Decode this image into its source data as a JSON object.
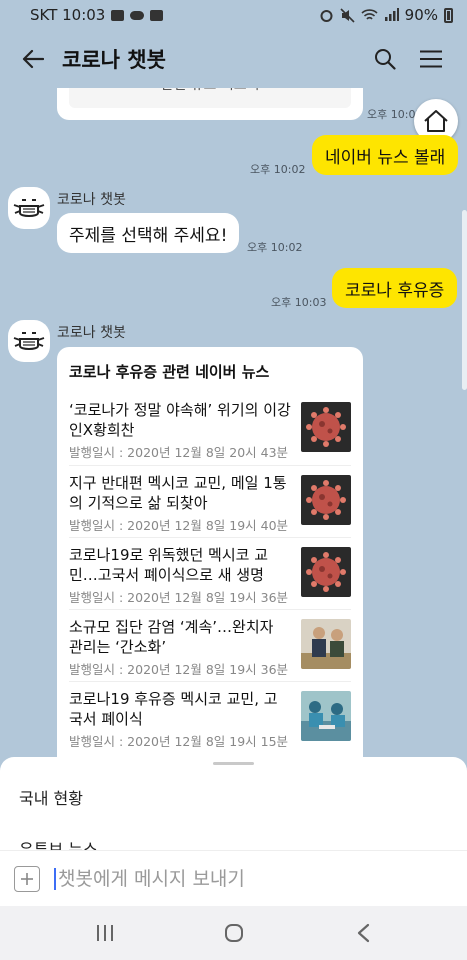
{
  "status_bar": {
    "carrier_time": "SKT 10:03",
    "battery": "90%"
  },
  "header": {
    "title": "코로나 챗봇",
    "icons": [
      "back-arrow-icon",
      "search-icon",
      "menu-icon"
    ]
  },
  "chat": {
    "partial_card_button": "관련 뉴스 더보기",
    "messages": {
      "m1_time": "오후 10:02",
      "m2_text": "네이버 뉴스 볼래",
      "m2_time": "오후 10:02",
      "m3_sender": "코로나 챗봇",
      "m3_text": "주제를 선택해 주세요!",
      "m3_time": "오후 10:02",
      "m4_text": "코로나 후유증",
      "m4_time": "오후 10:03",
      "m5_sender": "코로나 챗봇"
    },
    "news_card": {
      "title": "코로나 후유증 관련 네이버 뉴스",
      "items": [
        {
          "headline": "‘코로나가 정말 야속해’ 위기의 이강인X황희찬",
          "date": "발행일시 : 2020년 12월 8일 20시 43분",
          "thumb": "virus-image"
        },
        {
          "headline": "지구 반대편 멕시코 교민, 메일 1통의 기적으로 삶 되찾아",
          "date": "발행일시 : 2020년 12월 8일 19시 40분",
          "thumb": "virus-image"
        },
        {
          "headline": "코로나19로 위독했던 멕시코 교민…고국서 폐이식으로 새 생명",
          "date": "발행일시 : 2020년 12월 8일 19시 36분",
          "thumb": "virus-image"
        },
        {
          "headline": "소규모 집단 감염 ‘계속’…완치자 관리는 ‘간소화’",
          "date": "발행일시 : 2020년 12월 8일 19시 36분",
          "thumb": "meeting-photo"
        },
        {
          "headline": "코로나19 후유증 멕시코 교민, 고국서 폐이식",
          "date": "발행일시 : 2020년 12월 8일 19시 15분",
          "thumb": "hospital-photo"
        }
      ]
    }
  },
  "bottom_sheet": {
    "items": [
      "국내 현황",
      "유튜브 뉴스"
    ]
  },
  "input": {
    "placeholder": "챗봇에게 메시지 보내기"
  },
  "colors": {
    "chat_background": "#b2c7d9",
    "my_bubble": "#fee500",
    "bot_bubble": "#ffffff",
    "cursor": "#3d6ef5"
  }
}
